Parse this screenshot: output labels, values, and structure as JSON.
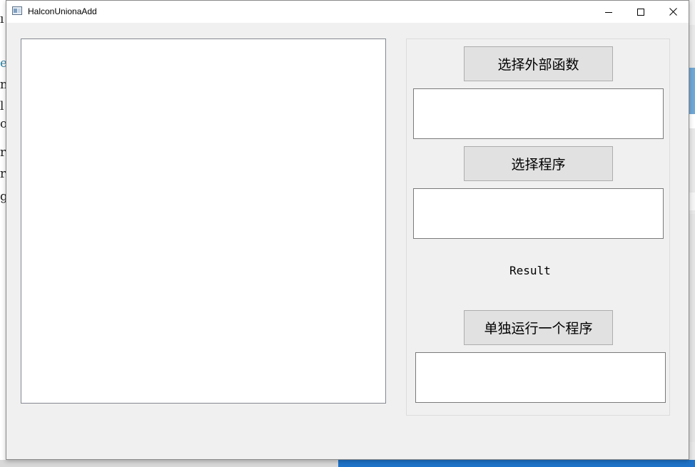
{
  "background": {
    "left_text_fragments": [
      "ı",
      "e",
      "n",
      "l",
      "o",
      "r",
      "r",
      "g"
    ]
  },
  "window": {
    "title": "HalconUnionaAdd",
    "controls": {
      "minimize": "minimize-icon",
      "maximize": "maximize-icon",
      "close": "close-icon"
    }
  },
  "buttons": {
    "select_external_function": "选择外部函数",
    "select_program": "选择程序",
    "run_single_program": "单独运行一个程序"
  },
  "labels": {
    "result": "Result"
  },
  "fields": {
    "external_function_path": "",
    "program_path": "",
    "run_output": ""
  },
  "colors": {
    "window_bg": "#f0f0f0",
    "button_bg": "#e1e1e1",
    "button_border": "#adadad",
    "taskbar_accent": "#1e73c8"
  }
}
